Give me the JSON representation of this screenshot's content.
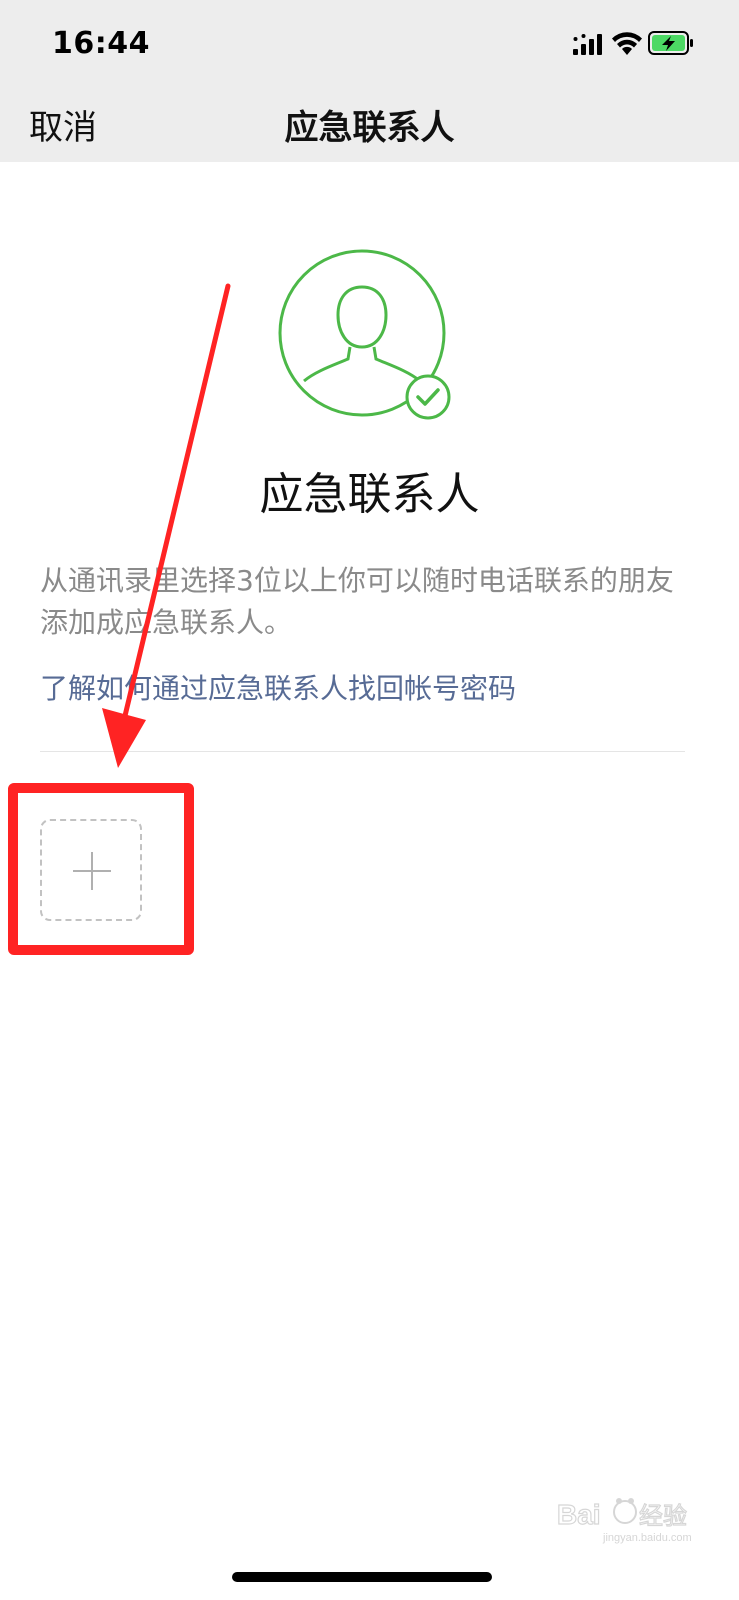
{
  "status_bar": {
    "time": "16:44",
    "icons": [
      "signal-icon",
      "wifi-icon",
      "battery-charging-icon"
    ]
  },
  "nav": {
    "cancel_label": "取消",
    "title": "应急联系人"
  },
  "main": {
    "avatar_icon": "user-verified-icon",
    "heading": "应急联系人",
    "description": "从通讯录里选择3位以上你可以随时电话联系的朋友添加成应急联系人。",
    "link_text": "了解如何通过应急联系人找回帐号密码",
    "add_icon": "plus-icon"
  },
  "annotation": {
    "arrow_color": "#ff2323",
    "highlight_color": "#ff2323"
  },
  "watermark": {
    "text": "jingyan.baidu.com"
  },
  "colors": {
    "accent_green": "#4cb848",
    "link_blue": "#576b95",
    "topbar_bg": "#ededed",
    "battery_green": "#4cd964"
  }
}
